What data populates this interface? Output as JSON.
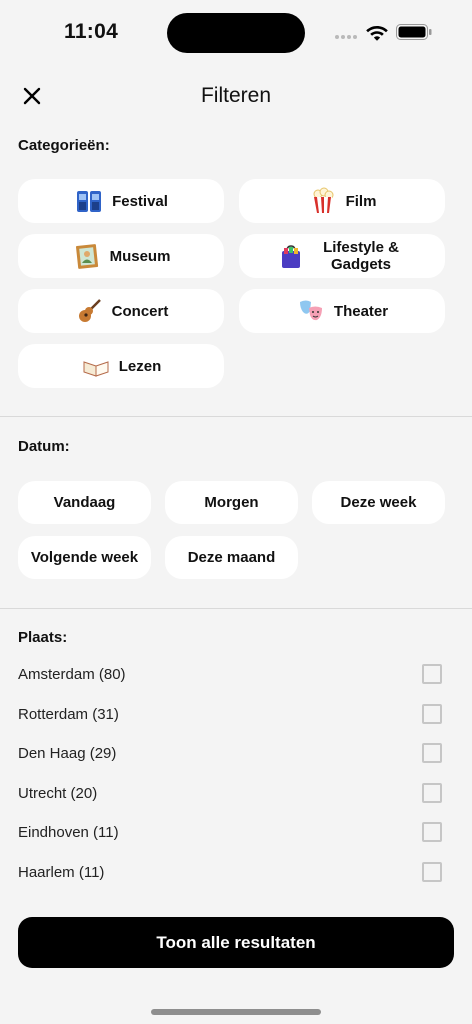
{
  "status_bar": {
    "time": "11:04"
  },
  "header": {
    "title": "Filteren",
    "close_icon": "close-icon"
  },
  "categories": {
    "title": "Categorieën:",
    "items": [
      {
        "label": "Festival",
        "icon": "festival-icon"
      },
      {
        "label": "Film",
        "icon": "popcorn-icon"
      },
      {
        "label": "Museum",
        "icon": "framed-picture-icon"
      },
      {
        "label": "Lifestyle & Gadgets",
        "icon": "shopping-bag-icon"
      },
      {
        "label": "Concert",
        "icon": "guitar-icon"
      },
      {
        "label": "Theater",
        "icon": "theater-masks-icon"
      },
      {
        "label": "Lezen",
        "icon": "open-book-icon"
      }
    ]
  },
  "date": {
    "title": "Datum:",
    "items": [
      "Vandaag",
      "Morgen",
      "Deze week",
      "Volgende week",
      "Deze maand"
    ]
  },
  "place": {
    "title": "Plaats:",
    "items": [
      {
        "label": "Amsterdam (80)",
        "checked": false
      },
      {
        "label": "Rotterdam (31)",
        "checked": false
      },
      {
        "label": "Den Haag (29)",
        "checked": false
      },
      {
        "label": "Utrecht (20)",
        "checked": false
      },
      {
        "label": "Eindhoven (11)",
        "checked": false
      },
      {
        "label": "Haarlem (11)",
        "checked": false
      }
    ]
  },
  "cta": {
    "label": "Toon alle resultaten"
  },
  "colors": {
    "background": "#f4f4f4",
    "chip": "#ffffff",
    "button": "#000000",
    "checkbox_border": "#c6c6c6"
  }
}
